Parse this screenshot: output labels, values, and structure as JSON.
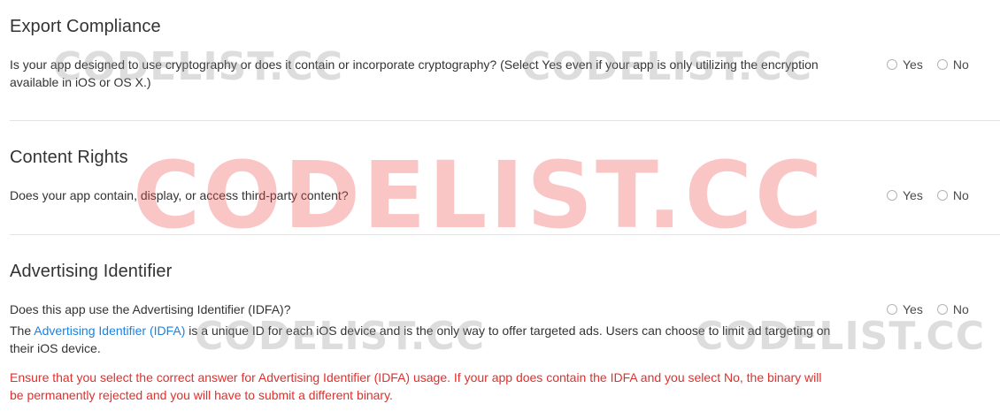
{
  "sections": {
    "export": {
      "heading": "Export Compliance",
      "question_line1": "Is your app designed to use cryptography or does it contain or incorporate cryptography? (Select Yes even if your app is only utilizing the encryption",
      "question_line2": "available in iOS or OS X.)",
      "yes_label": "Yes",
      "no_label": "No"
    },
    "content": {
      "heading": "Content Rights",
      "question": "Does your app contain, display, or access third-party content?",
      "yes_label": "Yes",
      "no_label": "No"
    },
    "advertising": {
      "heading": "Advertising Identifier",
      "question": "Does this app use the Advertising Identifier (IDFA)?",
      "yes_label": "Yes",
      "no_label": "No",
      "info_prefix": "The ",
      "info_link": "Advertising Identifier (IDFA)",
      "info_suffix_line1": " is a unique ID for each iOS device and is the only way to offer targeted ads. Users can choose to limit ad targeting on",
      "info_line2": "their iOS device.",
      "warning_line1": "Ensure that you select the correct answer for Advertising Identifier (IDFA) usage. If your app does contain the IDFA and you select No, the binary will",
      "warning_line2": "be permanently rejected and you will have to submit a different binary."
    }
  },
  "watermark": {
    "small": "CODELIST.CC",
    "large": "CODELIST.CC"
  },
  "colors": {
    "link": "#1a82e2",
    "warning": "#e0302c",
    "divider": "#e3e3e3",
    "watermark_red": "#ef5050"
  }
}
